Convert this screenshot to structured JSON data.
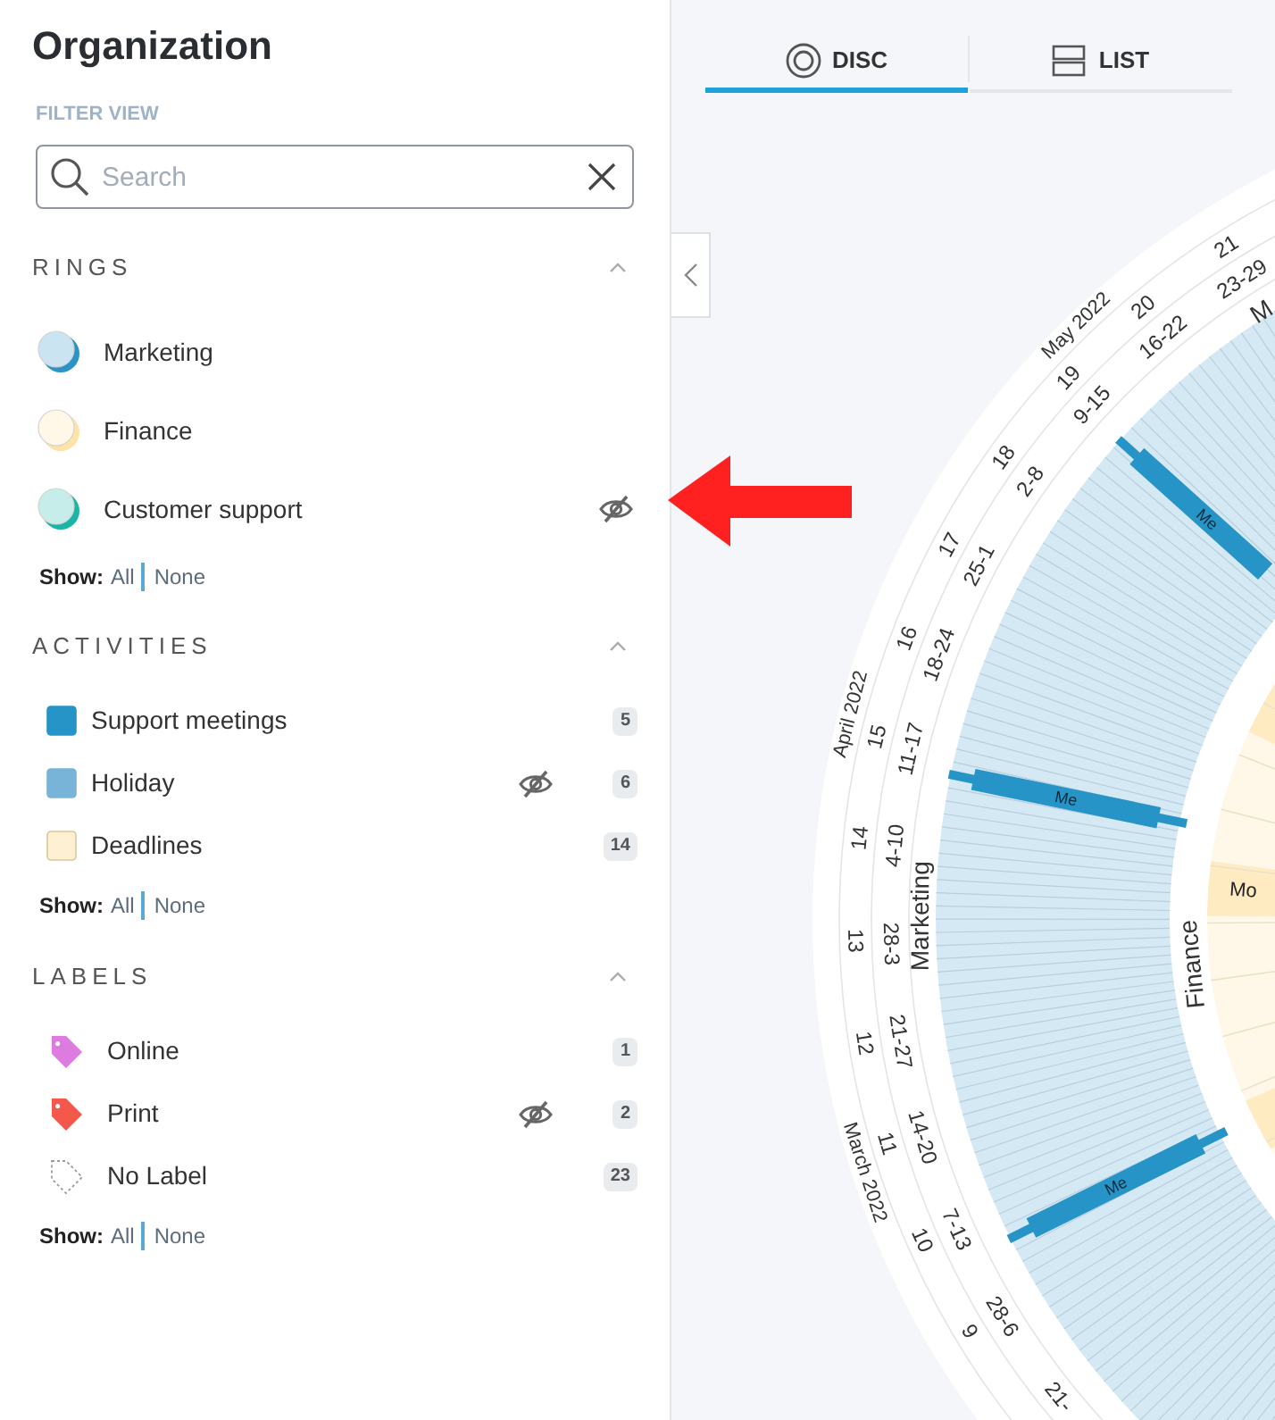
{
  "sidebar": {
    "title": "Organization",
    "filter_label": "FILTER VIEW",
    "search": {
      "placeholder": "Search"
    },
    "sections": [
      {
        "kind": "rings",
        "heading": "RINGS",
        "expanded": true,
        "items": [
          {
            "name": "Marketing",
            "color": "#2b93c6",
            "hidden": false
          },
          {
            "name": "Finance",
            "color": "#fde3a8",
            "hidden": false
          },
          {
            "name": "Customer support",
            "color": "#1bb5a5",
            "hidden": true
          }
        ],
        "show": {
          "label": "Show:",
          "all": "All",
          "none": "None"
        }
      },
      {
        "kind": "activities",
        "heading": "ACTIVITIES",
        "expanded": true,
        "items": [
          {
            "name": "Support meetings",
            "color": "#2794c7",
            "hidden": false,
            "count": "5"
          },
          {
            "name": "Holiday",
            "color": "#78b4d8",
            "hidden": true,
            "count": "6"
          },
          {
            "name": "Deadlines",
            "color": "#fdf0d3",
            "hidden": false,
            "count": "14"
          }
        ],
        "show": {
          "label": "Show:",
          "all": "All",
          "none": "None"
        }
      },
      {
        "kind": "labels",
        "heading": "LABELS",
        "expanded": true,
        "items": [
          {
            "name": "Online",
            "kind": "tag",
            "color": "#dd7be0",
            "hidden": false,
            "count": "1"
          },
          {
            "name": "Print",
            "kind": "tag",
            "color": "#f4584a",
            "hidden": true,
            "count": "2"
          },
          {
            "name": "No Label",
            "kind": "none",
            "hidden": false,
            "count": "23"
          }
        ],
        "show": {
          "label": "Show:",
          "all": "All",
          "none": "None"
        }
      }
    ]
  },
  "view_tabs": [
    {
      "label": "DISC",
      "selected": true
    },
    {
      "label": "LIST",
      "selected": false
    }
  ],
  "disc": {
    "months": [
      {
        "label": "May 2022"
      },
      {
        "label": "April 2022"
      },
      {
        "label": "March 2022"
      }
    ],
    "weeks": [
      {
        "number": "21",
        "range": "23-29"
      },
      {
        "number": "20",
        "range": "16-22"
      },
      {
        "number": "19",
        "range": "9-15"
      },
      {
        "number": "18",
        "range": "2-8"
      },
      {
        "number": "17",
        "range": "25-1"
      },
      {
        "number": "16",
        "range": "18-24"
      },
      {
        "number": "15",
        "range": "11-17"
      },
      {
        "number": "14",
        "range": "4-10"
      },
      {
        "number": "13",
        "range": "28-3"
      },
      {
        "number": "12",
        "range": "21-27"
      },
      {
        "number": "11",
        "range": "14-20"
      },
      {
        "number": "10",
        "range": "7-13"
      },
      {
        "number": "9",
        "range": "28-6"
      },
      {
        "range": "21-"
      }
    ],
    "ring_labels": [
      {
        "label": "M"
      },
      {
        "label": "Marketing"
      },
      {
        "label": "Finance"
      }
    ],
    "events": [
      {
        "label": "Me"
      },
      {
        "label": "Me"
      },
      {
        "label": "Me"
      }
    ],
    "finance_cells": [
      {
        "label": "Mo"
      }
    ]
  }
}
